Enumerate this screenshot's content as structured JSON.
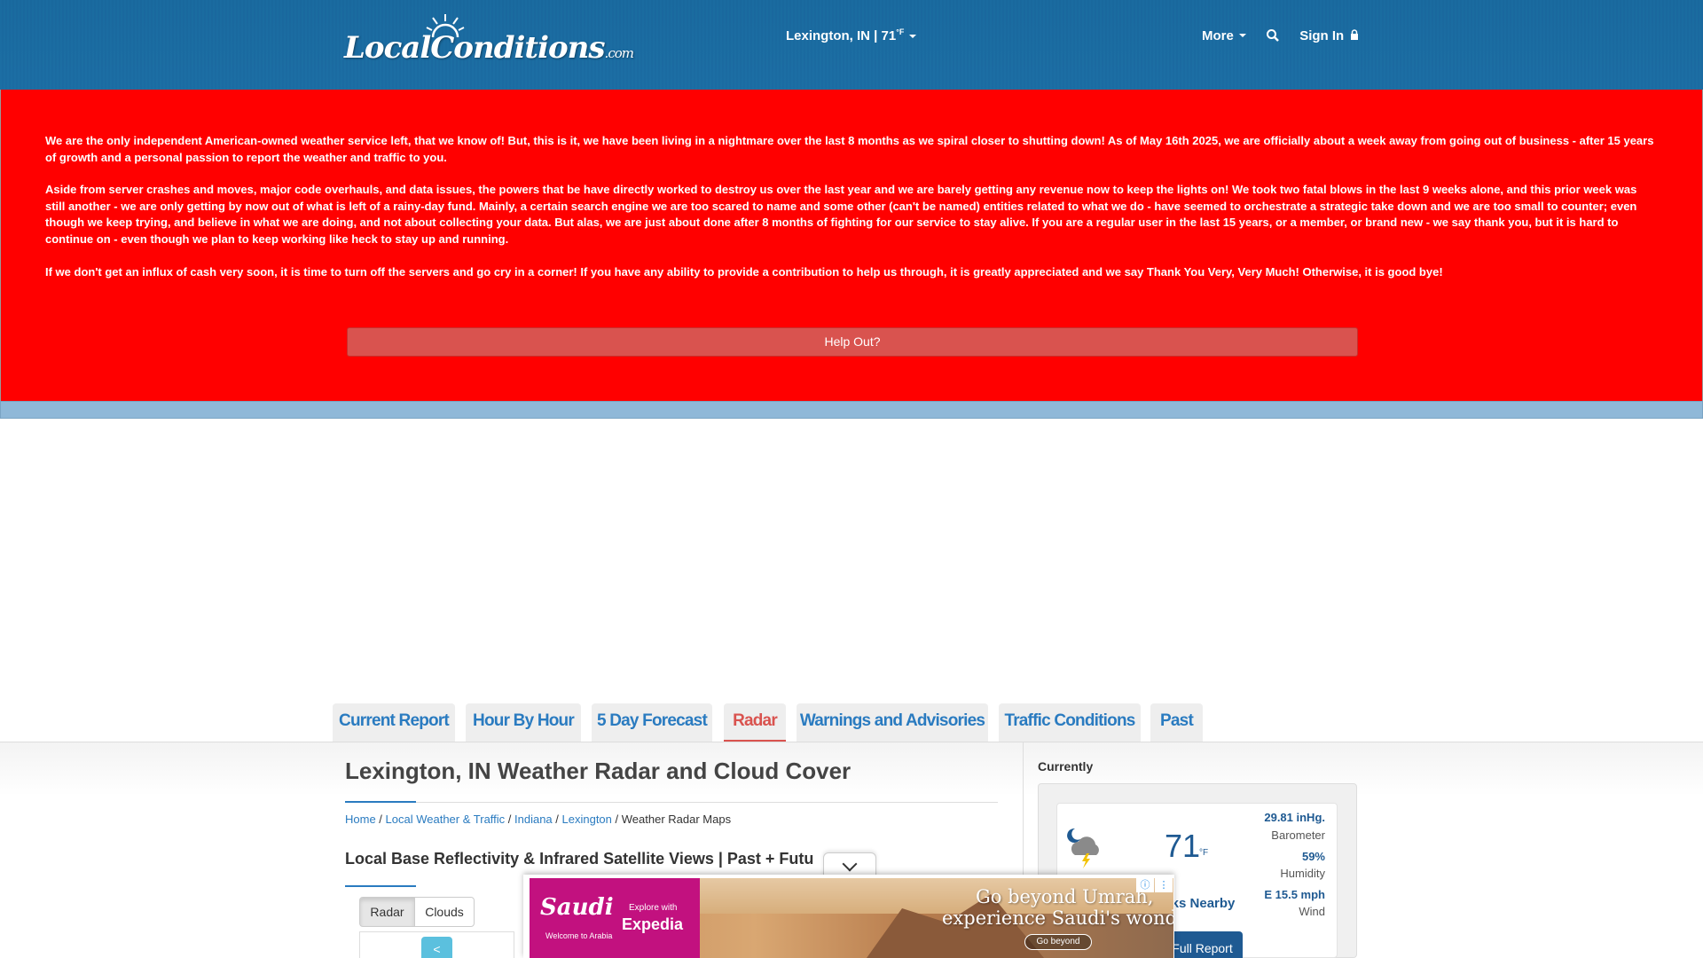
{
  "header": {
    "logo_text": "LocalConditions",
    "logo_suffix": ".com",
    "location": "Lexington, IN | 71",
    "location_unit": "°F",
    "more_label": "More",
    "signin_label": "Sign In",
    "colors": {
      "bar": "#1b6ea3"
    }
  },
  "banner": {
    "paragraph_1": "We are the only independent American-owned weather service left, that we know of! But, this is it, we have been living in a nightmare over the last 8 months as we spiral closer to shutting down! As of May 16th 2025, we are officially about a week away from going out of business - after 15 years of growth and a personal passion to report the weather and traffic to you.",
    "paragraph_2": "Aside from server crashes and moves, major code overhauls, and data issues, the powers that be have directly worked to destroy us over the last year and we are barely getting any revenue now to keep the lights on! We took two fatal blows in the last 9 weeks alone, and this prior week was still another - we are only getting by now out of what is left of a rainy-day fund. Mainly, a certain search engine we are too scared to name and some other (can't be named) entities related to what we do - have seemed to orchestrate a strategic take down and we are too small to counter; even though we keep trying, and believe in what we are doing, and not about collecting your data. But alas, we are just about done after 8 months of fighting for our service to stay alive. If you are a regular user in the last 15 years, or a member, or brand new - we say thank you, but it is hard to continue on - even though we plan to keep working like heck to stay up and running.",
    "paragraph_3": "If we don't get an influx of cash very soon, it is time to turn off the servers and go cry in a corner! If you have any ability to provide a contribution to help us through, it is greatly appreciated and we say Thank You Very, Very Much! Otherwise, it is good bye!",
    "help_button": "Help Out?",
    "colors": {
      "background": "#ff0000",
      "button": "#d9534f"
    }
  },
  "tabs": [
    {
      "label": "Current Report",
      "active": false
    },
    {
      "label": "Hour By Hour",
      "active": false
    },
    {
      "label": "5 Day Forecast",
      "active": false
    },
    {
      "label": "Radar",
      "active": true
    },
    {
      "label": "Warnings and Advisories",
      "active": false
    },
    {
      "label": "Traffic Conditions",
      "active": false
    },
    {
      "label": "Past",
      "active": false
    }
  ],
  "main": {
    "title": "Lexington, IN Weather Radar and Cloud Cover",
    "breadcrumb": {
      "home": "Home",
      "local": "Local Weather & Traffic",
      "state": "Indiana",
      "city": "Lexington",
      "current": "Weather Radar Maps",
      "separator": " / "
    },
    "subtitle": "Local Base Reflectivity & Infrared Satellite Views | Past + Futu",
    "toggle_radar": "Radar",
    "toggle_clouds": "Clouds",
    "prev_label": "<"
  },
  "side": {
    "heading": "Currently",
    "icon": "night-thunderstorm-icon",
    "temperature": "71",
    "temp_unit": "°F",
    "barometer_value": "29.81 inHg.",
    "barometer_label": "Barometer",
    "humidity_value": "59%",
    "humidity_label": "Humidity",
    "wind_value": "E 15.5 mph",
    "wind_label": "Wind",
    "condition_partial": "eaks Nearby",
    "full_report": "Full Report"
  },
  "ad": {
    "brand": "Saudi",
    "welcome": "Welcome to Arabia",
    "explore": "Explore with",
    "partner": "Expedia",
    "headline_1": "Go beyond Umrah,",
    "headline_2": "experience Saudi's wonders",
    "cta": "Go beyond",
    "info_icon": "ⓘ",
    "menu_icon": "⋮"
  }
}
